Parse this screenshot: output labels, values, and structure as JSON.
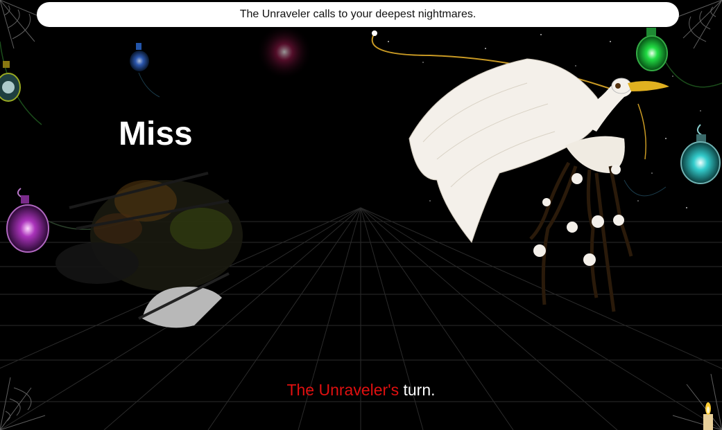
{
  "banner": {
    "text": "The Unraveler calls to your deepest nightmares."
  },
  "combat": {
    "result_text": "Miss"
  },
  "turn": {
    "actor": "The Unraveler's",
    "suffix": " turn."
  },
  "colors": {
    "background": "#000000",
    "banner_bg": "#ffffff",
    "actor_text": "#e01010",
    "turn_text": "#ffffff",
    "grid_lines": "#3a3a3a",
    "potion_green": "#22dd44",
    "potion_cyan": "#33cccc",
    "potion_purple": "#aa33bb",
    "potion_blue": "#3366cc"
  },
  "icons": [
    "spider-web-icon",
    "potion-icon",
    "candle-icon",
    "enemy-creature",
    "player-pet"
  ]
}
